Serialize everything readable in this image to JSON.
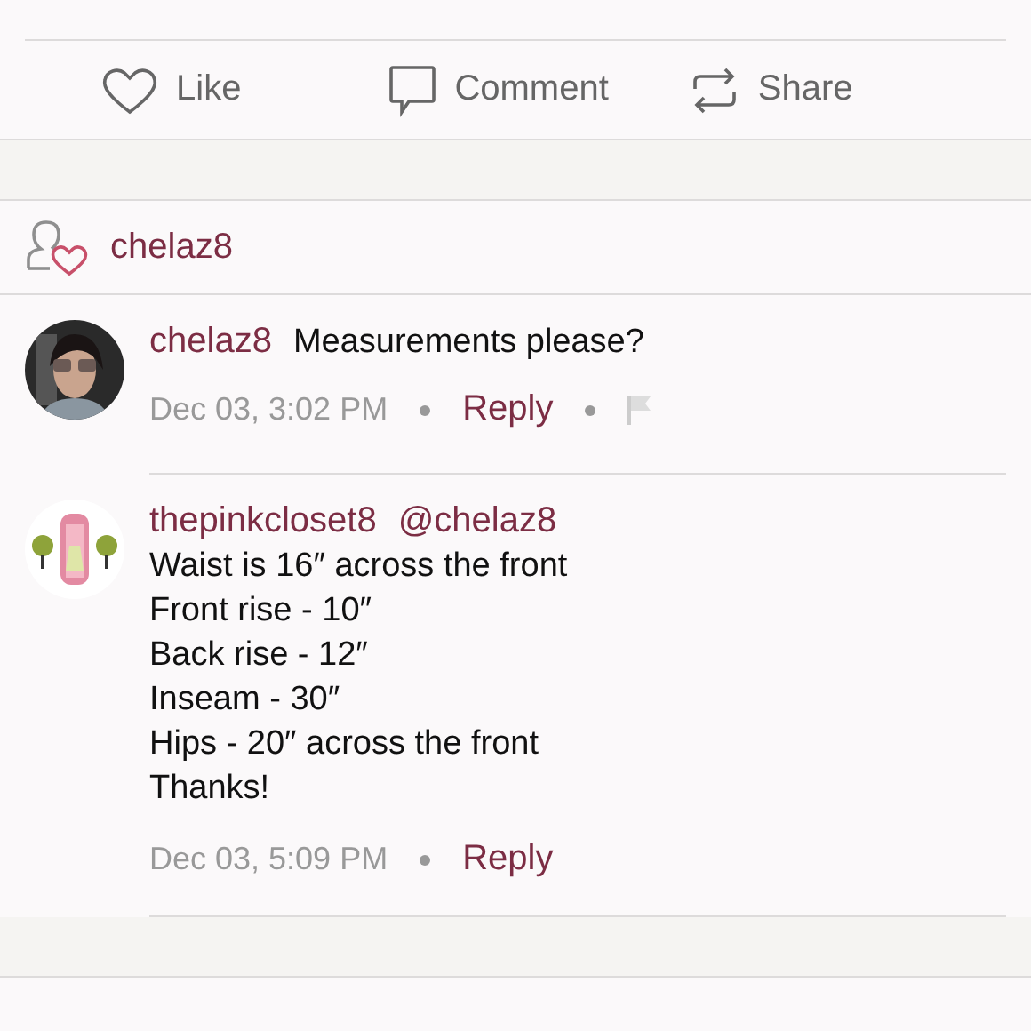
{
  "actions": [
    {
      "kind": "like",
      "label": "Like"
    },
    {
      "kind": "comment",
      "label": "Comment"
    },
    {
      "kind": "share",
      "label": "Share"
    }
  ],
  "likes": {
    "users": [
      "chelaz8"
    ]
  },
  "comments": [
    {
      "author": "chelaz8",
      "lines": [
        "Measurements please?"
      ],
      "time": "Dec 03, 3:02 PM",
      "reply": "Reply",
      "flag": true
    },
    {
      "author": "thepinkcloset8",
      "mention": "@chelaz8",
      "lines": [
        "Waist is 16″ across the front",
        "Front rise - 10″",
        "Back rise - 12″",
        "Inseam - 30″",
        "Hips - 20″ across the front",
        "Thanks!"
      ],
      "time": "Dec 03, 5:09 PM",
      "reply": "Reply",
      "flag": false
    }
  ]
}
